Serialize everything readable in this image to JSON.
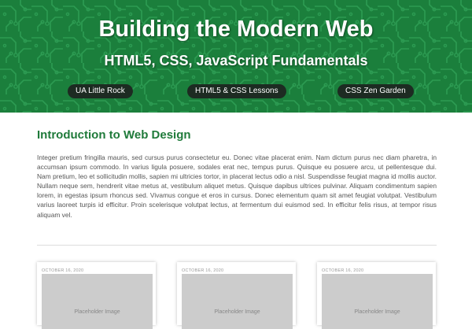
{
  "hero": {
    "title": "Building the Modern Web",
    "subtitle": "HTML5, CSS, JavaScript Fundamentals",
    "background_color": "#1b7f3c",
    "pattern_icon": "circuit-board-pattern"
  },
  "nav": {
    "links": [
      {
        "label": "UA Little Rock"
      },
      {
        "label": "HTML5 & CSS Lessons"
      },
      {
        "label": "CSS Zen Garden"
      }
    ],
    "pill_color": "#1d2b22"
  },
  "intro": {
    "heading": "Introduction to Web Design",
    "heading_color": "#1f7a3a",
    "body": "Integer pretium fringilla mauris, sed cursus purus consectetur eu. Donec vitae placerat enim. Nam dictum purus nec diam pharetra, in accumsan ipsum commodo. In varius ligula posuere, sodales erat nec, tempus purus. Quisque eu posuere arcu, ut pellentesque dui. Nam pretium, leo et sollicitudin mollis, sapien mi ultricies tortor, in placerat lectus odio a nisl. Suspendisse feugiat magna id mollis auctor. Nullam neque sem, hendrerit vitae metus at, vestibulum aliquet metus. Quisque dapibus ultrices pulvinar. Aliquam condimentum sapien lorem, in egestas ipsum rhoncus sed. Vivamus congue et eros in cursus. Donec elementum quam sit amet feugiat volutpat. Vestibulum varius laoreet turpis id efficitur. Proin scelerisque volutpat lectus, at fermentum dui euismod sed. In efficitur felis risus, at tempor risus aliquam vel."
  },
  "cards": [
    {
      "date": "October 16, 2020",
      "image_label": "Placeholder Image"
    },
    {
      "date": "October 16, 2020",
      "image_label": "Placeholder Image"
    },
    {
      "date": "October 16, 2020",
      "image_label": "Placeholder Image"
    }
  ]
}
